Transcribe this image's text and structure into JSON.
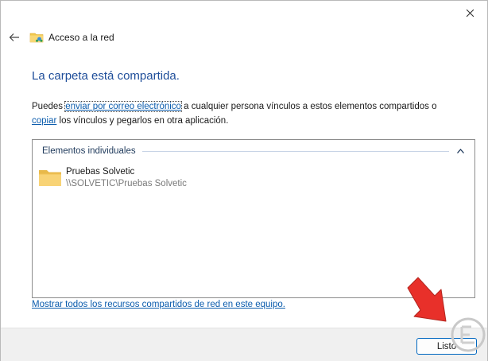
{
  "window": {
    "title": "Acceso a la red",
    "close_label": "×"
  },
  "content": {
    "heading": "La carpeta está compartida.",
    "desc_prefix": "Puedes ",
    "email_link": "enviar por correo electrónico",
    "desc_middle": " a cualquier persona vínculos a estos elementos compartidos o ",
    "copy_link": "copiar",
    "desc_suffix": " los vínculos y pegarlos en otra aplicación."
  },
  "list": {
    "group_title": "Elementos individuales",
    "items": [
      {
        "name": "Pruebas Solvetic",
        "path": "\\\\SOLVETIC\\Pruebas Solvetic",
        "icon": "folder-icon"
      }
    ]
  },
  "links": {
    "show_all": "Mostrar todos los recursos compartidos de red en este equipo."
  },
  "footer": {
    "done_label": "Listo"
  },
  "colors": {
    "heading": "#1f4e9a",
    "link": "#0b5cad",
    "arrow": "#e8302a",
    "button_border": "#0067c0"
  }
}
